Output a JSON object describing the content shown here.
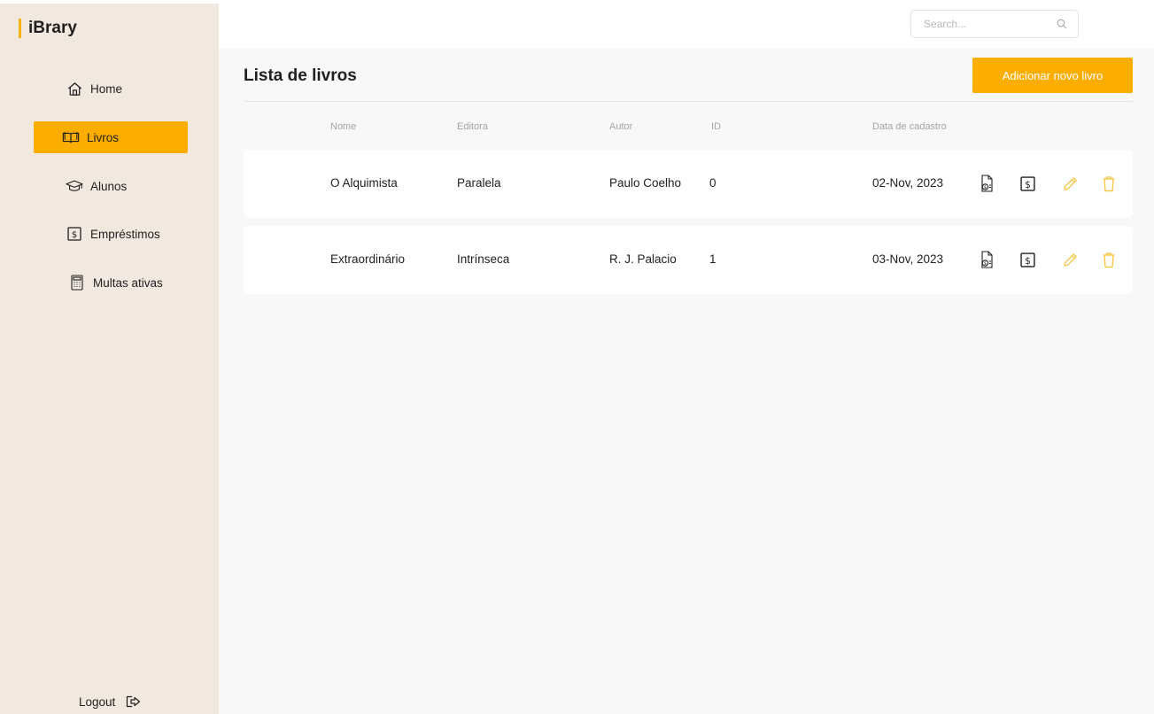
{
  "app": {
    "name": "iBrary"
  },
  "sidebar": {
    "items": [
      {
        "label": "Home",
        "icon": "home-icon"
      },
      {
        "label": "Livros",
        "icon": "book-icon",
        "active": true
      },
      {
        "label": "Alunos",
        "icon": "graduation-cap-icon"
      },
      {
        "label": "Empréstimos",
        "icon": "dollar-box-icon"
      },
      {
        "label": "Multas ativas",
        "icon": "calculator-icon"
      }
    ],
    "logout_label": "Logout"
  },
  "search": {
    "placeholder": "Search..."
  },
  "page": {
    "title": "Lista de livros",
    "add_button_label": "Adicionar novo livro"
  },
  "table": {
    "headers": {
      "nome": "Nome",
      "editora": "Editora",
      "autor": "Autor",
      "id": "ID",
      "data": "Data de cadastro"
    },
    "rows": [
      {
        "nome": "O Alquimista",
        "editora": "Paralela",
        "autor": "Paulo Coelho",
        "id": "0",
        "data": "02-Nov, 2023"
      },
      {
        "nome": "Extraordinário",
        "editora": "Intrínseca",
        "autor": "R. J. Palacio",
        "id": "1",
        "data": "03-Nov, 2023"
      }
    ]
  },
  "colors": {
    "accent": "#fbad00",
    "sidebar_bg": "#f1e8df",
    "main_bg": "#f8f8f8",
    "action_icon": "#f9c33c"
  }
}
